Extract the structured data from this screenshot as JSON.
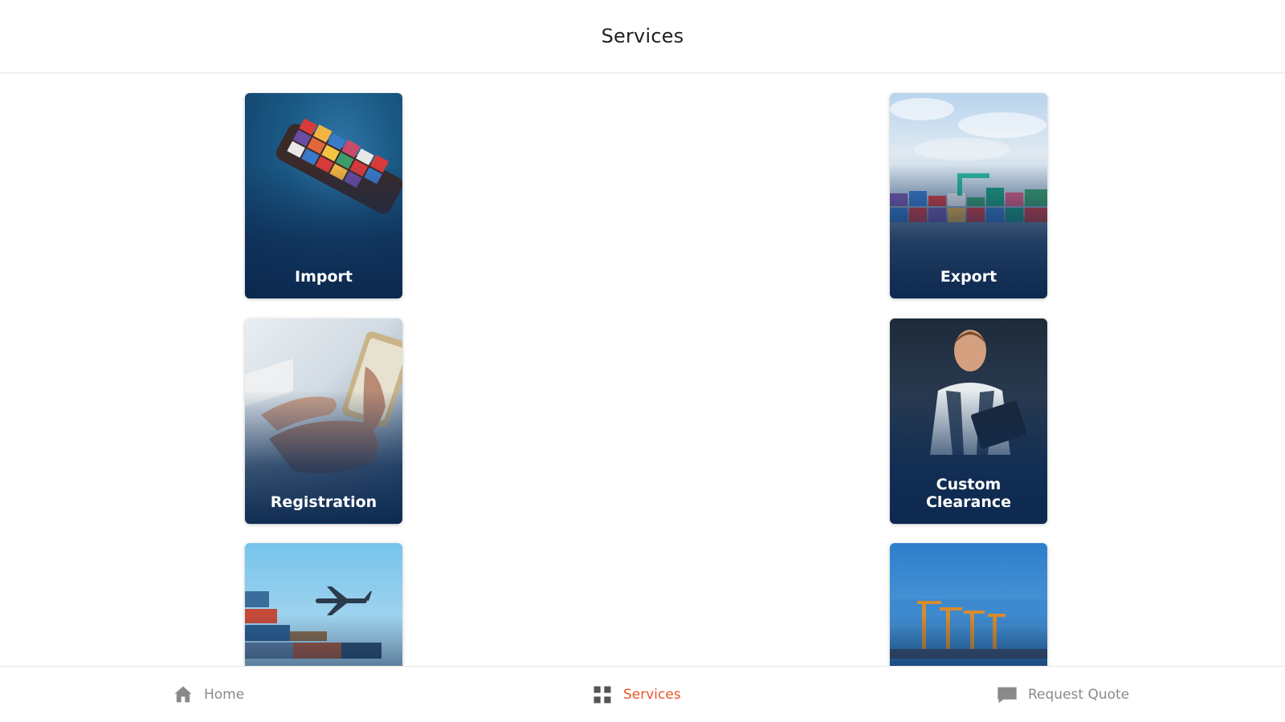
{
  "header": {
    "title": "Services"
  },
  "cards": [
    {
      "label": "Import"
    },
    {
      "label": "Export"
    },
    {
      "label": "Registration"
    },
    {
      "label": "Custom\nClearance"
    },
    {
      "label": ""
    },
    {
      "label": ""
    }
  ],
  "bottom_nav": {
    "items": [
      {
        "label": "Home",
        "icon": "home-icon",
        "active": false
      },
      {
        "label": "Services",
        "icon": "grid-icon",
        "active": true
      },
      {
        "label": "Request Quote",
        "icon": "chat-icon",
        "active": false
      }
    ]
  },
  "colors": {
    "accent": "#e8542a",
    "inactive": "#8a8a8a",
    "card_overlay": "#0e2c54"
  }
}
